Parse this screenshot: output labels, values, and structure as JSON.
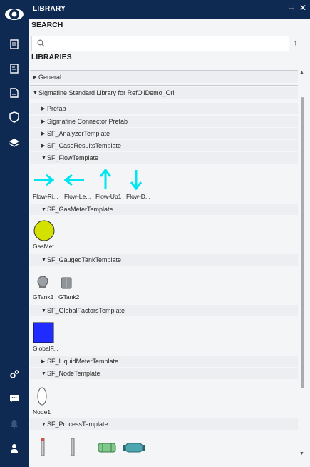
{
  "header": {
    "title": "LIBRARY",
    "pin_icon": "pin-icon",
    "close_icon": "close-icon"
  },
  "search": {
    "title": "SEARCH",
    "placeholder": "",
    "value": ""
  },
  "libraries_title": "LIBRARIES",
  "tree": {
    "general": "General",
    "standard_lib": "Sigmafine Standard Library for RefOilDemo_Ori",
    "items": [
      "Prefab",
      "Sigmafine Connector Prefab",
      "SF_AnalyzerTemplate",
      "SF_CaseResultsTemplate",
      "SF_FlowTemplate",
      "SF_GasMeterTemplate",
      "SF_GaugedTankTemplate",
      "SF_GlobalFactorsTemplate",
      "SF_LiquidMeterTemplate",
      "SF_NodeTemplate",
      "SF_ProcessTemplate"
    ],
    "flow_tiles": [
      "Flow-Ri...",
      "Flow-Le...",
      "Flow-Up1",
      "Flow-D..."
    ],
    "gasmeter_tiles": [
      "GasMet..."
    ],
    "gaugedtank_tiles": [
      "GTank1",
      "GTank2"
    ],
    "globalfactors_tiles": [
      "GlobalF..."
    ],
    "node_tiles": [
      "Node1"
    ]
  },
  "colors": {
    "nav": "#0f2a52",
    "accent": "#00e5f0",
    "gas": "#d4e000",
    "global": "#1f2bff"
  }
}
